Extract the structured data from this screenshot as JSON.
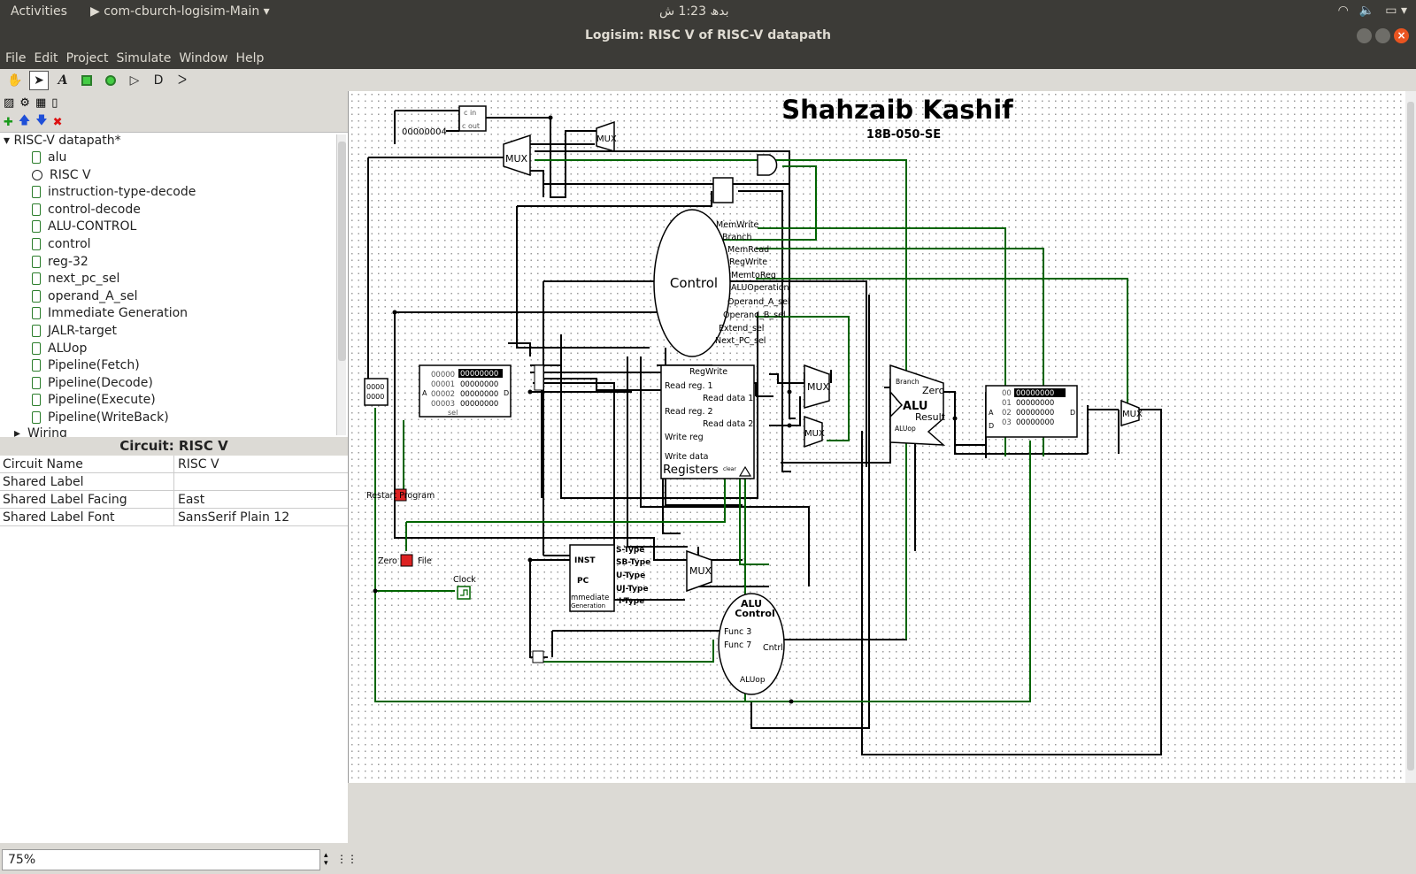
{
  "topbar": {
    "activities": "Activities",
    "app_menu": "com-cburch-logisim-Main",
    "clock": "بدھ 1:23 ش"
  },
  "window": {
    "title": "Logisim: RISC V of RISC-V datapath"
  },
  "menu": [
    "File",
    "Edit",
    "Project",
    "Simulate",
    "Window",
    "Help"
  ],
  "toolbar": {
    "tools": [
      "hand-tool",
      "select-tool",
      "text-tool",
      "input-pin",
      "output-pin",
      "not-gate",
      "and-gate",
      "or-gate"
    ],
    "selected": "select-tool"
  },
  "tree": {
    "root": "RISC-V datapath*",
    "items": [
      "alu",
      "RISC V",
      "instruction-type-decode",
      "control-decode",
      "ALU-CONTROL",
      "control",
      "reg-32",
      "next_pc_sel",
      "operand_A_sel",
      "Immediate Generation",
      "JALR-target",
      "ALUop",
      "Pipeline(Fetch)",
      "Pipeline(Decode)",
      "Pipeline(Execute)",
      "Pipeline(WriteBack)",
      "Wiring"
    ],
    "open_item": "RISC V"
  },
  "properties": {
    "title": "Circuit: RISC V",
    "rows": [
      {
        "key": "Circuit Name",
        "value": "RISC V"
      },
      {
        "key": "Shared Label",
        "value": ""
      },
      {
        "key": "Shared Label Facing",
        "value": "East"
      },
      {
        "key": "Shared Label Font",
        "value": "SansSerif Plain 12"
      }
    ]
  },
  "zoom": "75%",
  "circuit": {
    "title": "Shahzaib Kashif",
    "subtitle": "18B-050-SE",
    "const_pc_inc": "00000004",
    "control_label": "Control",
    "control_signals": [
      "MemWrite",
      "Branch",
      "MemRead",
      "RegWrite",
      "MemtoReg",
      "ALUOperation",
      "Operand_A_sel",
      "Operand_B_sel",
      "Extend_sel",
      "Next_PC_sel"
    ],
    "registers": {
      "title": "Registers",
      "top": "RegWrite",
      "ports": [
        "Read reg. 1",
        "Read reg. 2",
        "Write reg",
        "Write data",
        "Read data 1",
        "Read data 2"
      ],
      "clear": "clear"
    },
    "alu": {
      "label": "ALU",
      "zero": "Zero",
      "result": "Result",
      "branch": "Branch",
      "aluop": "ALUop"
    },
    "alu_control": {
      "title1": "ALU",
      "title2": "Control",
      "func3": "Func 3",
      "func7": "Func 7",
      "cntrl": "Cntrl",
      "aluop": "ALUop"
    },
    "imm_gen": {
      "inst": "INST",
      "pc": "PC",
      "label1": "mmediate",
      "label2": "Generation",
      "types": [
        "S-Type",
        "SB-Type",
        "U-Type",
        "UJ-Type",
        "I-Type"
      ]
    },
    "inst_mem": {
      "rows": [
        "00000",
        "00001",
        "00002",
        "00003"
      ],
      "data": [
        "00000000",
        "00000000",
        "00000000",
        "00000000"
      ],
      "a": "A",
      "d": "D",
      "sel": "sel"
    },
    "data_mem": {
      "rows": [
        "00",
        "01",
        "02",
        "03"
      ],
      "data": [
        "00000000",
        "00000000",
        "00000000",
        "00000000"
      ],
      "a": "A",
      "d": "D",
      "d2": "D"
    },
    "pc_reg": {
      "top": "0000",
      "bottom": "0000"
    },
    "mux_label": "MUX",
    "labels": {
      "restart": "Restart Program",
      "zero": "Zero",
      "file": "File",
      "clock": "Clock",
      "cin": "c in",
      "cout": "c out"
    }
  }
}
